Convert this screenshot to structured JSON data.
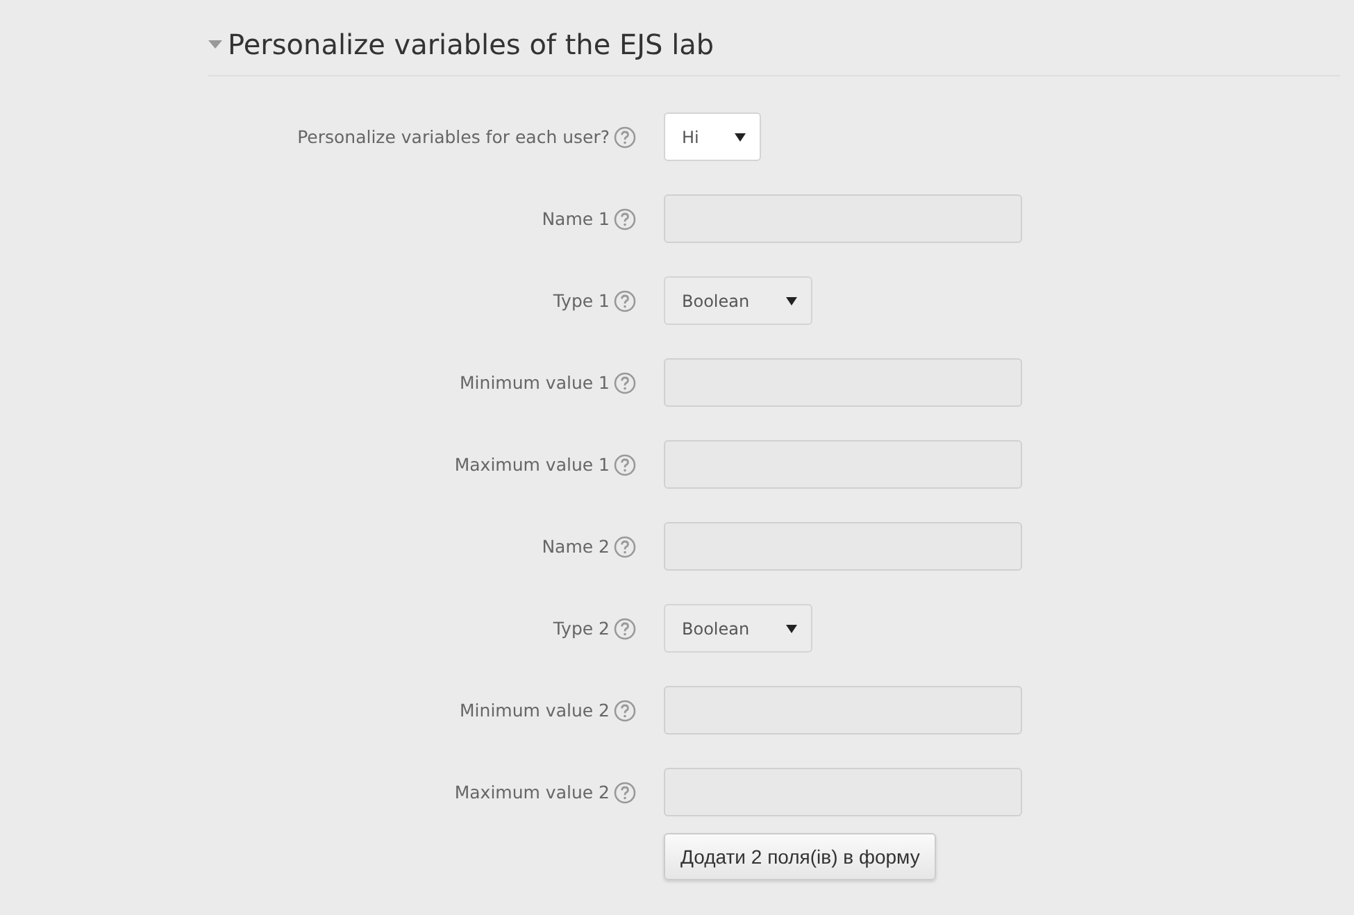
{
  "section": {
    "title": "Personalize variables of the EJS lab",
    "expanded": true
  },
  "fields": [
    {
      "label": "Personalize variables for each user?",
      "kind": "select",
      "value": "Hi",
      "disabled": false
    },
    {
      "label": "Name 1",
      "kind": "text",
      "disabled": true
    },
    {
      "label": "Type 1",
      "kind": "select",
      "value": "Boolean",
      "disabled": true
    },
    {
      "label": "Minimum value 1",
      "kind": "text",
      "disabled": true
    },
    {
      "label": "Maximum value 1",
      "kind": "text",
      "disabled": true
    },
    {
      "label": "Name 2",
      "kind": "text",
      "disabled": true
    },
    {
      "label": "Type 2",
      "kind": "select",
      "value": "Boolean",
      "disabled": true
    },
    {
      "label": "Minimum value 2",
      "kind": "text",
      "disabled": true
    },
    {
      "label": "Maximum value 2",
      "kind": "text",
      "disabled": true
    }
  ],
  "button": "Додати 2 поля(ів) в форму"
}
